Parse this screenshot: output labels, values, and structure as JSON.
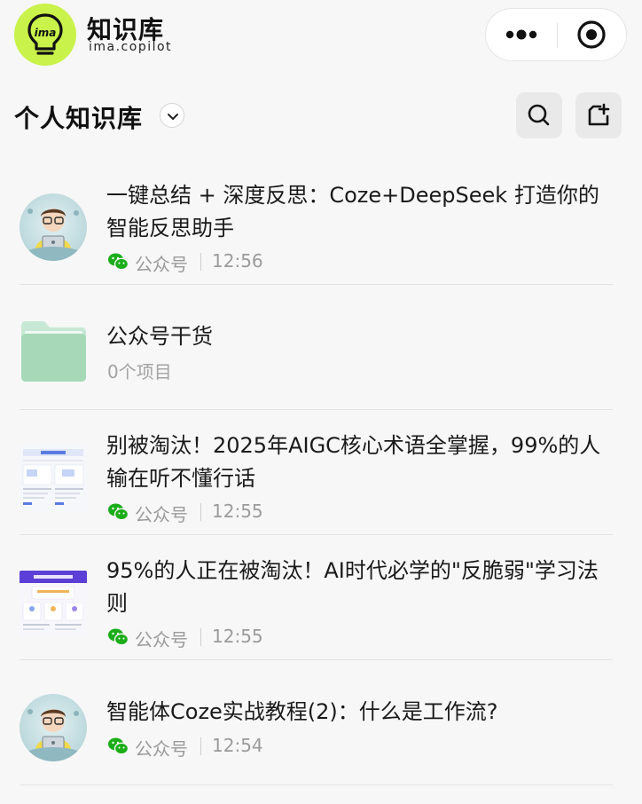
{
  "app": {
    "name": "知识库",
    "subtitle": "ima.copilot",
    "logo_text": "ima",
    "accent": "#c9f24a"
  },
  "capsule": {
    "more_icon": "more-dots-icon",
    "target_icon": "target-icon"
  },
  "header": {
    "title": "个人知识库",
    "search_icon": "search-icon",
    "add_icon": "add-folder-icon"
  },
  "items": [
    {
      "kind": "article",
      "thumb": "avatar",
      "title": "一键总结 + 深度反思：Coze+DeepSeek 打造你的智能反思助手",
      "source": "公众号",
      "time": "12:56"
    },
    {
      "kind": "folder",
      "title": "公众号干货",
      "count": "0个项目"
    },
    {
      "kind": "article",
      "thumb": "doc-aigc",
      "title": "别被淘汰！2025年AIGC核心术语全掌握，99%的人输在听不懂行话",
      "source": "公众号",
      "time": "12:55"
    },
    {
      "kind": "article",
      "thumb": "doc-purple",
      "title": "95%的人正在被淘汰！AI时代必学的\"反脆弱\"学习法则",
      "source": "公众号",
      "time": "12:55"
    },
    {
      "kind": "article",
      "thumb": "avatar",
      "title": "智能体Coze实战教程(2)：什么是工作流?",
      "source": "公众号",
      "time": "12:54"
    }
  ]
}
